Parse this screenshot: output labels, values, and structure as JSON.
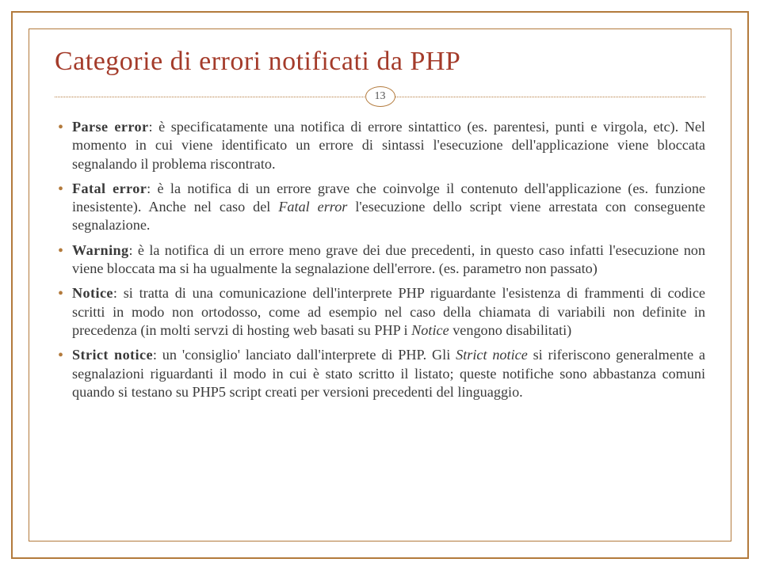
{
  "title": "Categorie di errori notificati da PHP",
  "page_number": "13",
  "items": [
    {
      "term": "Parse error",
      "body_html": ": è specificatamente una notifica di errore sintattico (es. parentesi, punti e virgola, etc). Nel momento in cui viene identificato un errore di sintassi l'esecuzione dell'applicazione viene bloccata segnalando il problema riscontrato."
    },
    {
      "term": "Fatal error",
      "body_html": ": è la notifica di un errore grave che coinvolge il contenuto dell'applicazione (es. funzione inesistente). Anche nel caso del <span class=\"ital\">Fatal error</span> l'esecuzione dello script viene arrestata con conseguente segnalazione."
    },
    {
      "term": "Warning",
      "body_html": ": è la notifica di un errore meno grave dei due precedenti, in questo caso infatti l'esecuzione non viene bloccata ma si ha ugualmente la segnalazione dell'errore. (es. parametro non passato)"
    },
    {
      "term": "Notice",
      "body_html": ": si tratta di una comunicazione dell'interprete PHP riguardante l'esistenza di frammenti di codice scritti in modo non ortodosso, come ad esempio nel caso della chiamata di variabili non definite in precedenza (in molti servzi di hosting web basati su PHP i <span class=\"ital\">Notice</span> vengono disabilitati)"
    },
    {
      "term": "Strict notice",
      "body_html": ": un 'consiglio' lanciato dall'interprete di PHP. Gli <span class=\"ital\">Strict notice</span> si riferiscono generalmente a segnalazioni riguardanti il modo in cui è stato scritto il listato; queste notifiche sono abbastanza comuni quando si testano su PHP5 script creati per versioni precedenti del linguaggio."
    }
  ]
}
